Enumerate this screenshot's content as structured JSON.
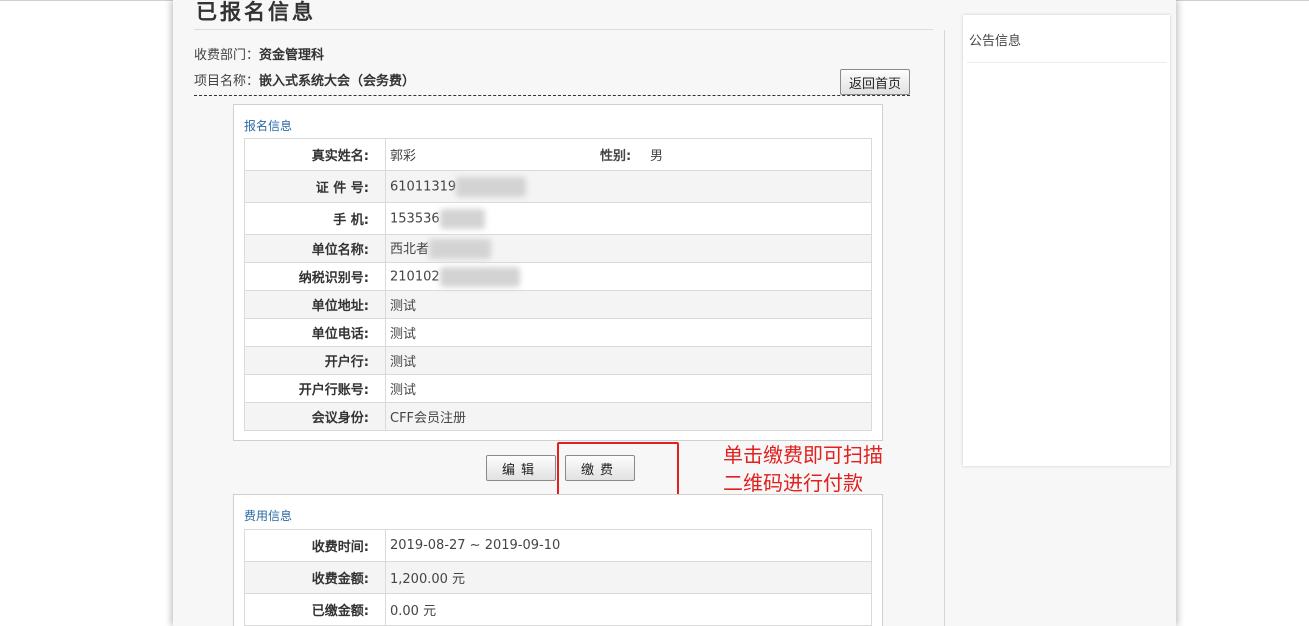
{
  "page": {
    "title": "已报名信息",
    "dept_label": "收费部门：",
    "dept_value": "资金管理科",
    "project_label": "项目名称：",
    "project_value": "嵌入式系统大会（会务费）",
    "home_button": "返回首页"
  },
  "registration": {
    "section_title": "报名信息",
    "name_label": "真实姓名:",
    "name_value": "郭彩",
    "gender_label": "性别:",
    "gender_value": "男",
    "rows": [
      {
        "label": "证  件 号:",
        "value": "61011319"
      },
      {
        "label": "手    机:",
        "value": "153536"
      },
      {
        "label": "单位名称:",
        "value": "西北者"
      },
      {
        "label": "纳税识别号:",
        "value": "210102"
      },
      {
        "label": "单位地址:",
        "value": "测试"
      },
      {
        "label": "单位电话:",
        "value": "测试"
      },
      {
        "label": "开户行:",
        "value": "测试"
      },
      {
        "label": "开户行账号:",
        "value": "测试"
      },
      {
        "label": "会议身份:",
        "value": "CFF会员注册"
      }
    ]
  },
  "actions": {
    "edit_label": "编辑",
    "pay_label": "缴费"
  },
  "annotation": {
    "line1": "单击缴费即可扫描",
    "line2": "二维码进行付款",
    "color": "#e0211f"
  },
  "fees": {
    "section_title": "费用信息",
    "rows": [
      {
        "label": "收费时间:",
        "value": "2019-08-27 ~ 2019-09-10"
      },
      {
        "label": "收费金额:",
        "value": "1,200.00 元"
      },
      {
        "label": "已缴金额:",
        "value": "0.00 元"
      }
    ]
  },
  "sidebar": {
    "notice_title": "公告信息"
  },
  "colors": {
    "accent_link": "#2b6aa3",
    "highlight_red": "#e0211f"
  }
}
